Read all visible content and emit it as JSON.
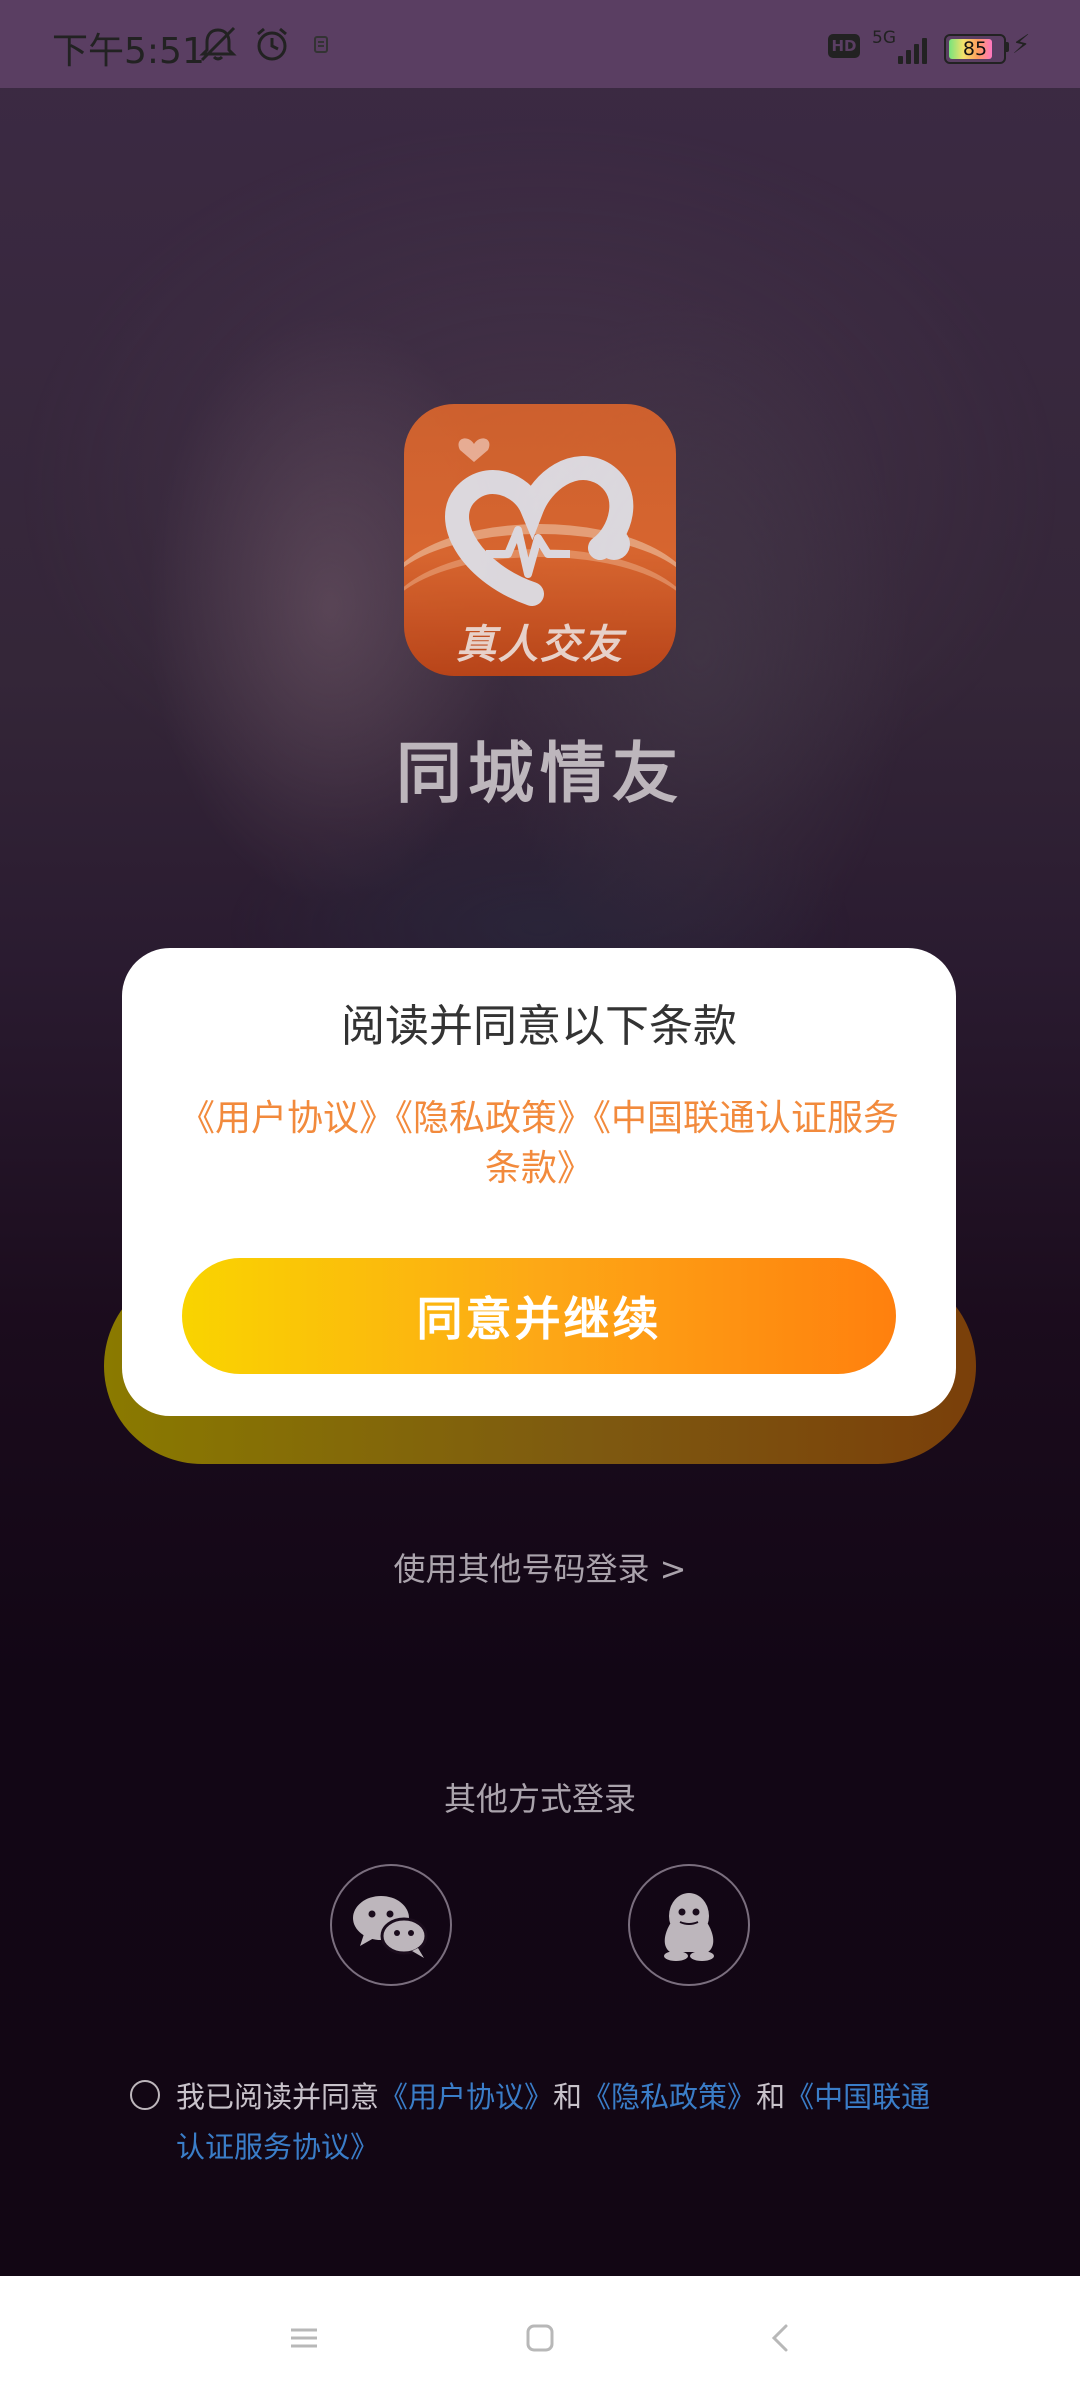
{
  "status_bar": {
    "time": "下午5:51",
    "icons": [
      "mute-bell-icon",
      "alarm-icon",
      "notification-app-icon"
    ],
    "hd_label": "HD",
    "network_label": "5G",
    "battery_level": "85",
    "charging": true
  },
  "app": {
    "logo_text": "真人交友",
    "name": "同城情友"
  },
  "dialog": {
    "title": "阅读并同意以下条款",
    "links_text": "《用户协议》《隐私政策》《中国联通认证服务条款》",
    "agree_button": "同意并继续"
  },
  "login": {
    "other_number": "使用其他号码登录 >",
    "other_methods_label": "其他方式登录",
    "methods": [
      "wechat-icon",
      "qq-icon"
    ]
  },
  "agreement": {
    "prefix": "我已阅读并同意",
    "user_agreement": "《用户协议》",
    "and1": "和",
    "privacy_policy": "《隐私政策》",
    "and2": "和",
    "unicom_terms": "《中国联通认证服务协议》",
    "checked": false
  },
  "nav": {
    "buttons": [
      "menu-icon",
      "home-icon",
      "back-icon"
    ]
  },
  "colors": {
    "status_bar": "#5a3e62",
    "accent_orange": "#f28a3c",
    "button_gradient_start": "#f9d400",
    "button_gradient_end": "#ff800e",
    "link_blue": "#3a7dc8"
  }
}
